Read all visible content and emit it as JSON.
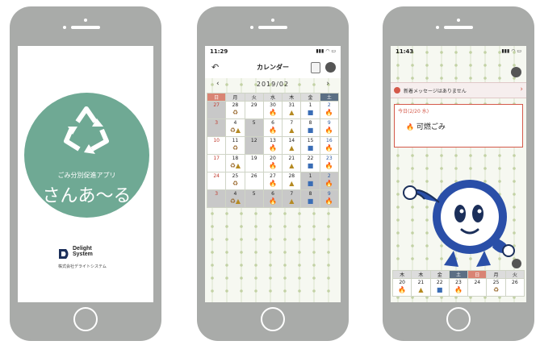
{
  "phone1": {
    "tagline": "ごみ分別促進アプリ",
    "app_name": "さんあ〜る",
    "company_logo_line1": "Delight",
    "company_logo_line2": "System",
    "company_name": "株式会社デライトシステム"
  },
  "phone2": {
    "time": "11:29",
    "title": "カレンダー",
    "month": "2019/02",
    "weekdays": [
      "日",
      "月",
      "火",
      "水",
      "木",
      "金",
      "土"
    ],
    "weeks": [
      [
        {
          "d": "27",
          "g": 1,
          "i": []
        },
        {
          "d": "28",
          "i": [
            "bottle"
          ]
        },
        {
          "d": "29",
          "i": []
        },
        {
          "d": "30",
          "i": [
            "burn"
          ]
        },
        {
          "d": "31",
          "i": [
            "glass"
          ]
        },
        {
          "d": "1",
          "i": [
            "pet"
          ]
        },
        {
          "d": "2",
          "i": [
            "burn"
          ]
        }
      ],
      [
        {
          "d": "3",
          "g": 1,
          "i": []
        },
        {
          "d": "4",
          "i": [
            "bottle",
            "glass"
          ]
        },
        {
          "d": "5",
          "g": 1,
          "i": []
        },
        {
          "d": "6",
          "i": [
            "burn"
          ]
        },
        {
          "d": "7",
          "i": [
            "glass"
          ]
        },
        {
          "d": "8",
          "i": [
            "pet"
          ]
        },
        {
          "d": "9",
          "i": [
            "burn"
          ]
        }
      ],
      [
        {
          "d": "10",
          "i": []
        },
        {
          "d": "11",
          "i": [
            "bottle"
          ]
        },
        {
          "d": "12",
          "g": 1,
          "i": []
        },
        {
          "d": "13",
          "i": [
            "burn"
          ]
        },
        {
          "d": "14",
          "i": [
            "glass"
          ]
        },
        {
          "d": "15",
          "i": [
            "pet"
          ]
        },
        {
          "d": "16",
          "i": [
            "burn"
          ]
        }
      ],
      [
        {
          "d": "17",
          "i": []
        },
        {
          "d": "18",
          "i": [
            "bottle",
            "glass"
          ]
        },
        {
          "d": "19",
          "i": []
        },
        {
          "d": "20",
          "i": [
            "burn"
          ]
        },
        {
          "d": "21",
          "i": [
            "glass"
          ]
        },
        {
          "d": "22",
          "i": [
            "pet"
          ]
        },
        {
          "d": "23",
          "i": [
            "burn"
          ]
        }
      ],
      [
        {
          "d": "24",
          "i": []
        },
        {
          "d": "25",
          "i": [
            "bottle"
          ]
        },
        {
          "d": "26",
          "i": []
        },
        {
          "d": "27",
          "i": [
            "burn"
          ]
        },
        {
          "d": "28",
          "i": [
            "glass"
          ]
        },
        {
          "d": "1",
          "g": 1,
          "i": [
            "pet"
          ]
        },
        {
          "d": "2",
          "g": 1,
          "i": [
            "burn"
          ]
        }
      ],
      [
        {
          "d": "3",
          "g": 1,
          "i": []
        },
        {
          "d": "4",
          "g": 1,
          "i": [
            "bottle",
            "glass"
          ]
        },
        {
          "d": "5",
          "g": 1,
          "i": []
        },
        {
          "d": "6",
          "g": 1,
          "i": [
            "burn"
          ]
        },
        {
          "d": "7",
          "g": 1,
          "i": [
            "glass"
          ]
        },
        {
          "d": "8",
          "g": 1,
          "i": [
            "pet"
          ]
        },
        {
          "d": "9",
          "g": 1,
          "i": [
            "burn"
          ]
        }
      ]
    ]
  },
  "phone3": {
    "time": "11:43",
    "message": "新着メッセージはありません",
    "today_label": "今日(2/20 水)",
    "today_item": "可燃ごみ",
    "weekdays": [
      "木",
      "木",
      "金",
      "土",
      "日",
      "月",
      "火"
    ],
    "days": [
      {
        "d": "20",
        "i": [
          "burn"
        ]
      },
      {
        "d": "21",
        "i": [
          "glass"
        ]
      },
      {
        "d": "22",
        "i": [
          "pet"
        ]
      },
      {
        "d": "23",
        "i": [
          "burn"
        ]
      },
      {
        "d": "24",
        "i": []
      },
      {
        "d": "25",
        "i": [
          "bottle"
        ]
      },
      {
        "d": "26",
        "i": []
      }
    ]
  },
  "icons": {
    "burn": "🔥",
    "bottle": "♻",
    "glass": "▲",
    "pet": "■",
    "plastic": "●"
  },
  "colors": {
    "accent_green": "#6fa994",
    "sunday": "#d98474",
    "saturday": "#5b6f84",
    "alert_red": "#d4594a"
  }
}
